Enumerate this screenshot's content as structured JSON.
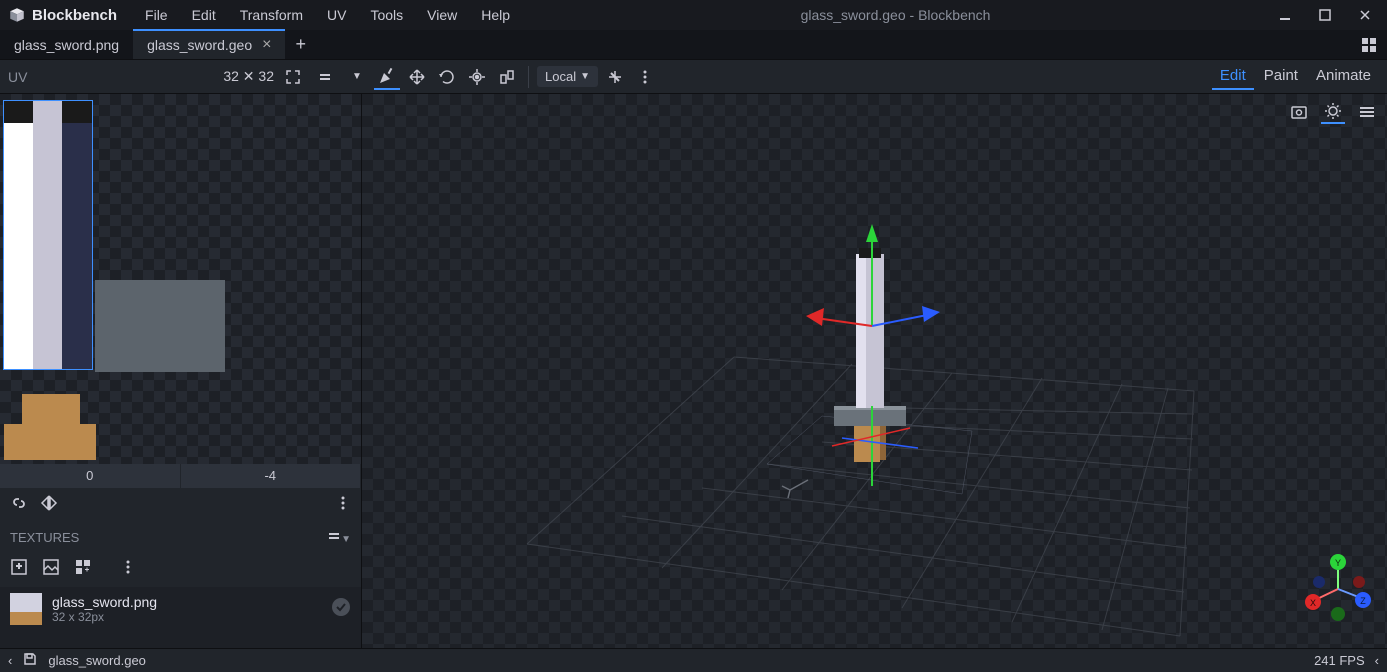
{
  "app": {
    "name": "Blockbench",
    "title": "glass_sword.geo - Blockbench"
  },
  "menu": {
    "file": "File",
    "edit": "Edit",
    "transform": "Transform",
    "uv": "UV",
    "tools": "Tools",
    "view": "View",
    "help": "Help"
  },
  "tabs": {
    "t0": "glass_sword.png",
    "t1": "glass_sword.geo"
  },
  "toolbar": {
    "uvlabel": "UV",
    "dim": "32 ✕ 32",
    "space": "Local"
  },
  "modes": {
    "edit": "Edit",
    "paint": "Paint",
    "animate": "Animate"
  },
  "uv": {
    "coord_x": "0",
    "coord_y": "-4"
  },
  "textures": {
    "header": "TEXTURES",
    "item": {
      "name": "glass_sword.png",
      "meta": "32 x 32px"
    }
  },
  "status": {
    "file": "glass_sword.geo",
    "fps": "241 FPS"
  }
}
